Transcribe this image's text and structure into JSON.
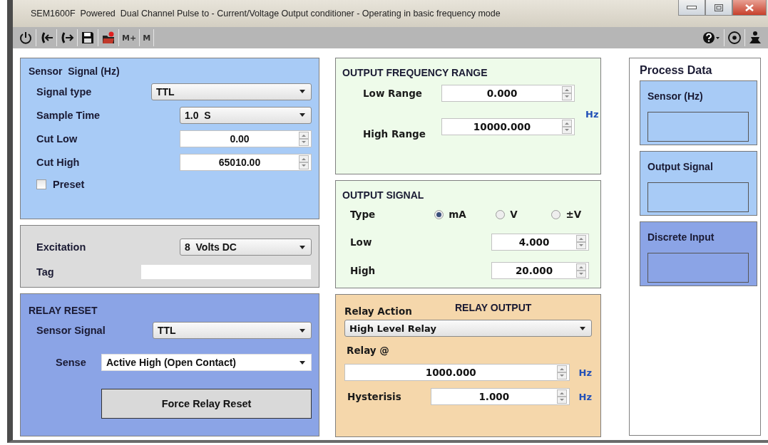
{
  "window": {
    "title": "SEM1600F  Powered  Dual Channel Pulse to - Current/Voltage Output conditioner - Operating in basic frequency mode"
  },
  "toolbar": {
    "left": [
      {
        "kind": "power"
      },
      {
        "kind": "disconnect"
      },
      {
        "kind": "connect"
      },
      {
        "kind": "save"
      },
      {
        "kind": "open"
      },
      {
        "kind": "text",
        "label": "M+"
      },
      {
        "kind": "text",
        "label": "M"
      }
    ],
    "right": [
      {
        "kind": "help"
      },
      {
        "kind": "target"
      },
      {
        "kind": "person"
      }
    ]
  },
  "sensor_signal": {
    "title": "Sensor  Signal (Hz)",
    "fields": [
      {
        "kind": "select",
        "label": "Signal type",
        "value": "TTL"
      },
      {
        "kind": "select",
        "label": "Sample Time",
        "value": "1.0  S"
      },
      {
        "kind": "spin",
        "label": "Cut Low",
        "value": "0.00"
      },
      {
        "kind": "spin",
        "label": "Cut High",
        "value": "65010.00"
      },
      {
        "kind": "checkbox",
        "label": "Preset",
        "checked": false
      }
    ]
  },
  "excitation": {
    "fields": [
      {
        "kind": "select",
        "label": "Excitation",
        "value": "8  Volts DC"
      },
      {
        "kind": "text",
        "label": "Tag"
      }
    ]
  },
  "relay_reset": {
    "title": "RELAY RESET",
    "fields": [
      {
        "kind": "select",
        "label": "Sensor Signal",
        "value": "TTL"
      },
      {
        "kind": "select",
        "label": "Sense",
        "value": "Active High (Open Contact)"
      }
    ],
    "button": "Force Relay Reset"
  },
  "output_frequency_range": {
    "title": "OUTPUT FREQUENCY RANGE",
    "fields": [
      {
        "kind": "spin",
        "label": "Low Range",
        "value": "0.000"
      },
      {
        "kind": "spin",
        "label": "High Range",
        "value": "10000.000"
      }
    ],
    "unit": "Hz"
  },
  "output_signal": {
    "title": "OUTPUT SIGNAL",
    "type_label": "Type",
    "types": [
      {
        "label": "mA",
        "selected": true
      },
      {
        "label": "V",
        "selected": false
      },
      {
        "label": "±V",
        "selected": false
      }
    ],
    "fields": [
      {
        "kind": "spin",
        "label": "Low",
        "value": "4.000"
      },
      {
        "kind": "spin",
        "label": "High",
        "value": "20.000"
      }
    ]
  },
  "relay_output": {
    "title": "RELAY OUTPUT",
    "action_label": "Relay Action",
    "action": "High Level Relay",
    "relay_at_label": "Relay @",
    "relay_at": "1000.000",
    "relay_at_unit": "Hz",
    "hysteresis_label": "Hysterisis",
    "hysteresis": "1.000",
    "hysteresis_unit": "Hz"
  },
  "process_data": {
    "title": "Process Data",
    "items": [
      {
        "label": "Sensor (Hz)",
        "color": "#a8cbf6"
      },
      {
        "label": "Output Signal",
        "color": "#a8cbf6"
      },
      {
        "label": "Discrete Input",
        "color": "#8ba4e6"
      }
    ]
  }
}
